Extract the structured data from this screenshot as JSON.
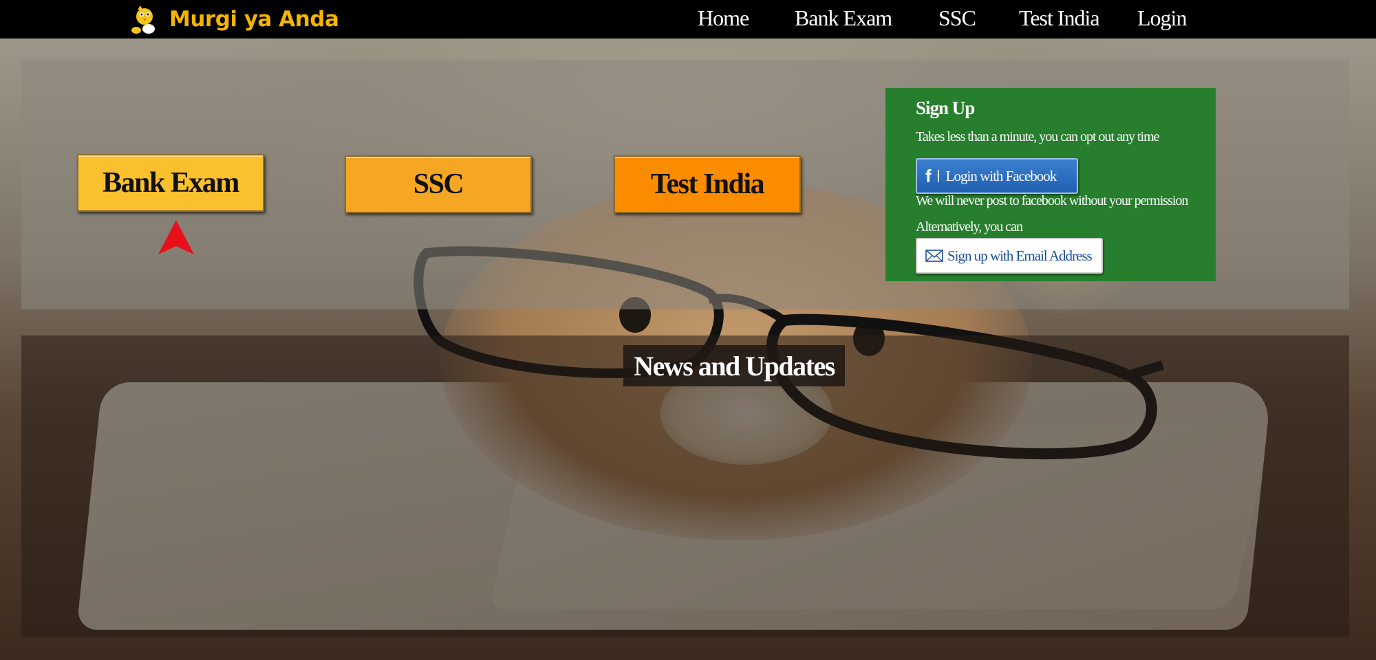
{
  "brand": {
    "name": "Murgi ya Anda",
    "logo_icon": "chick-egg-icon"
  },
  "nav": {
    "items": [
      {
        "label": "Home"
      },
      {
        "label": "Bank Exam"
      },
      {
        "label": "SSC"
      },
      {
        "label": "Test India"
      },
      {
        "label": "Login"
      }
    ]
  },
  "categories": [
    {
      "label": "Bank Exam",
      "color": "#fbc02d"
    },
    {
      "label": "SSC",
      "color": "#f5a623"
    },
    {
      "label": "Test India",
      "color": "#fb8c00"
    }
  ],
  "signup": {
    "title": "Sign Up",
    "subtitle": "Takes less than a minute, you can opt out any time",
    "facebook_icon_letter": "f",
    "facebook_button": "Login with Facebook",
    "facebook_note": "We will never post to facebook without your permission",
    "alternative": "Alternatively, you can",
    "email_button": "Sign up with Email Address"
  },
  "news": {
    "title": "News and Updates"
  },
  "colors": {
    "signup_bg": "#277f2e",
    "brand": "#f5b400",
    "arrow": "#e8101a",
    "facebook": "#2a6cc0"
  }
}
